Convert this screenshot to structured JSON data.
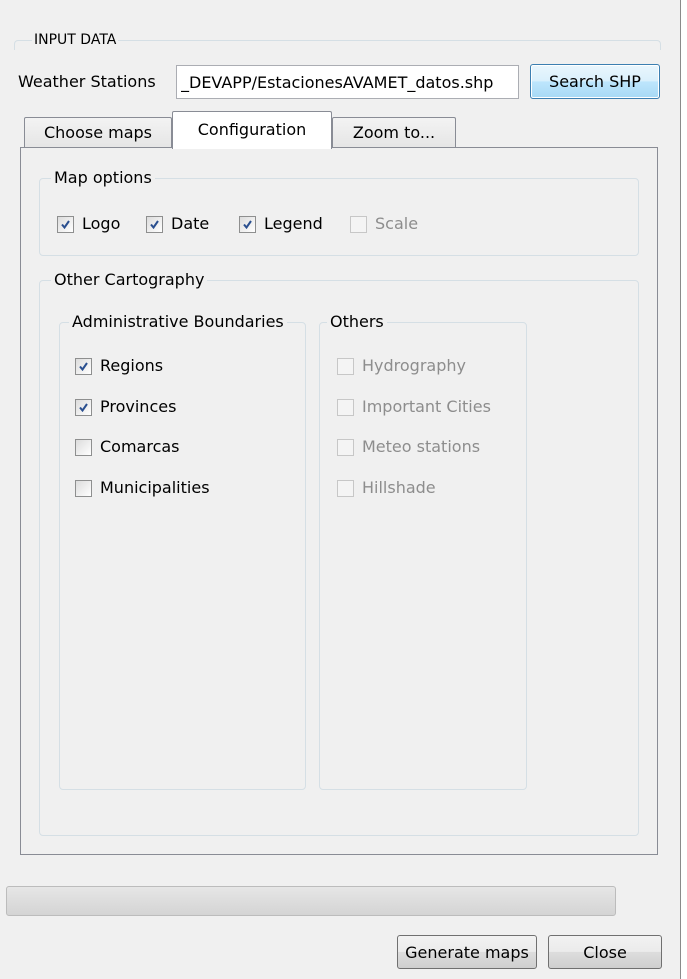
{
  "input_data": {
    "group_title": "INPUT DATA",
    "weather_label": "Weather Stations",
    "shp_path": "_DEVAPP/EstacionesAVAMET_datos.shp",
    "search_button": "Search SHP"
  },
  "tabs": [
    {
      "label": "Choose maps",
      "selected": false
    },
    {
      "label": "Configuration",
      "selected": true
    },
    {
      "label": "Zoom to...",
      "selected": false
    }
  ],
  "map_options": {
    "title": "Map options",
    "items": [
      {
        "label": "Logo",
        "checked": true,
        "enabled": true
      },
      {
        "label": "Date",
        "checked": true,
        "enabled": true
      },
      {
        "label": "Legend",
        "checked": true,
        "enabled": true
      },
      {
        "label": "Scale",
        "checked": false,
        "enabled": false
      }
    ]
  },
  "other_cartography": {
    "title": "Other Cartography",
    "admin": {
      "title": "Administrative Boundaries",
      "items": [
        {
          "label": "Regions",
          "checked": true,
          "enabled": true
        },
        {
          "label": "Provinces",
          "checked": true,
          "enabled": true
        },
        {
          "label": "Comarcas",
          "checked": false,
          "enabled": true
        },
        {
          "label": "Municipalities",
          "checked": false,
          "enabled": true
        }
      ]
    },
    "others": {
      "title": "Others",
      "items": [
        {
          "label": "Hydrography",
          "checked": false,
          "enabled": false
        },
        {
          "label": "Important Cities",
          "checked": false,
          "enabled": false
        },
        {
          "label": "Meteo stations",
          "checked": false,
          "enabled": false
        },
        {
          "label": "Hillshade",
          "checked": false,
          "enabled": false
        }
      ]
    }
  },
  "progress": {
    "value": 0
  },
  "buttons": {
    "generate": "Generate maps",
    "close": "Close"
  },
  "colors": {
    "check": "#2a4f8f",
    "accent_border": "#3c7fb1"
  }
}
